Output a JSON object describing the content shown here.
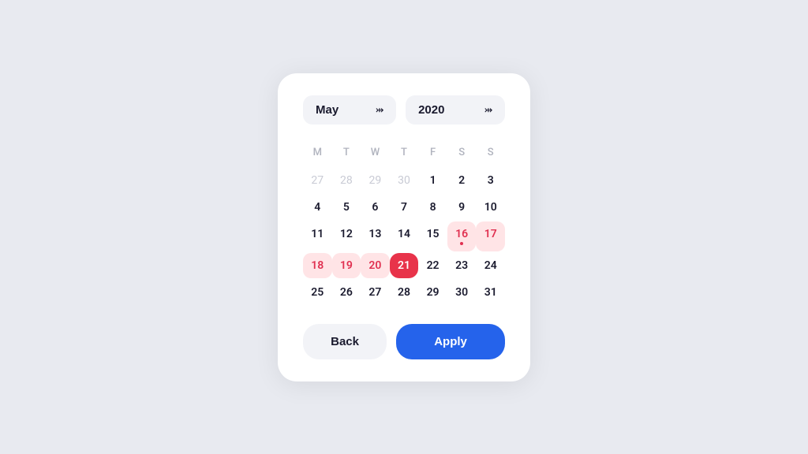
{
  "header": {
    "month_label": "May",
    "year_label": "2020",
    "chevron_month": "⌄",
    "chevron_year": "⌄"
  },
  "day_labels": [
    "M",
    "T",
    "W",
    "T",
    "F",
    "S",
    "S"
  ],
  "weeks": [
    [
      {
        "day": "27",
        "type": "muted"
      },
      {
        "day": "28",
        "type": "muted"
      },
      {
        "day": "29",
        "type": "muted"
      },
      {
        "day": "30",
        "type": "muted"
      },
      {
        "day": "1",
        "type": "normal"
      },
      {
        "day": "2",
        "type": "normal"
      },
      {
        "day": "3",
        "type": "normal"
      }
    ],
    [
      {
        "day": "4",
        "type": "normal"
      },
      {
        "day": "5",
        "type": "normal"
      },
      {
        "day": "6",
        "type": "normal"
      },
      {
        "day": "7",
        "type": "normal"
      },
      {
        "day": "8",
        "type": "normal"
      },
      {
        "day": "9",
        "type": "normal"
      },
      {
        "day": "10",
        "type": "normal"
      }
    ],
    [
      {
        "day": "11",
        "type": "normal"
      },
      {
        "day": "12",
        "type": "normal"
      },
      {
        "day": "13",
        "type": "normal"
      },
      {
        "day": "14",
        "type": "normal"
      },
      {
        "day": "15",
        "type": "normal"
      },
      {
        "day": "16",
        "type": "highlighted-dot"
      },
      {
        "day": "17",
        "type": "highlighted"
      }
    ],
    [
      {
        "day": "18",
        "type": "highlighted"
      },
      {
        "day": "19",
        "type": "highlighted"
      },
      {
        "day": "20",
        "type": "highlighted"
      },
      {
        "day": "21",
        "type": "selected"
      },
      {
        "day": "22",
        "type": "normal"
      },
      {
        "day": "23",
        "type": "normal"
      },
      {
        "day": "24",
        "type": "normal"
      }
    ],
    [
      {
        "day": "25",
        "type": "normal"
      },
      {
        "day": "26",
        "type": "normal"
      },
      {
        "day": "27",
        "type": "normal"
      },
      {
        "day": "28",
        "type": "normal"
      },
      {
        "day": "29",
        "type": "normal"
      },
      {
        "day": "30",
        "type": "normal"
      },
      {
        "day": "31",
        "type": "normal"
      }
    ]
  ],
  "footer": {
    "back_label": "Back",
    "apply_label": "Apply"
  }
}
